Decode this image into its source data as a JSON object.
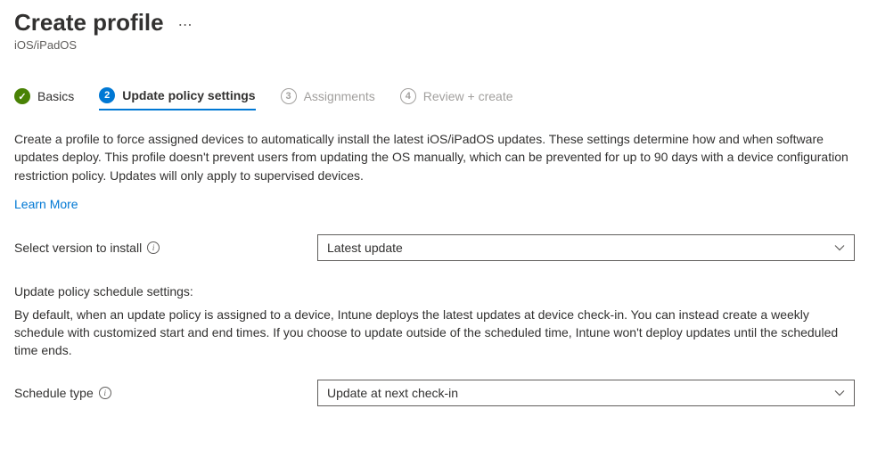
{
  "header": {
    "title": "Create profile",
    "subtitle": "iOS/iPadOS"
  },
  "wizard": {
    "step1": "Basics",
    "step2_num": "2",
    "step2": "Update policy settings",
    "step3_num": "3",
    "step3": "Assignments",
    "step4_num": "4",
    "step4": "Review + create"
  },
  "body": {
    "description": "Create a profile to force assigned devices to automatically install the latest iOS/iPadOS updates. These settings determine how and when software updates deploy. This profile doesn't prevent users from updating the OS manually, which can be prevented for up to 90 days with a device configuration restriction policy. Updates will only apply to supervised devices.",
    "learn_more": "Learn More",
    "version_label": "Select version to install",
    "version_value": "Latest update",
    "schedule_heading": "Update policy schedule settings:",
    "schedule_desc": "By default, when an update policy is assigned to a device, Intune deploys the latest updates at device check-in. You can instead create a weekly schedule with customized start and end times. If you choose to update outside of the scheduled time, Intune won't deploy updates until the scheduled time ends.",
    "schedule_type_label": "Schedule type",
    "schedule_type_value": "Update at next check-in"
  }
}
